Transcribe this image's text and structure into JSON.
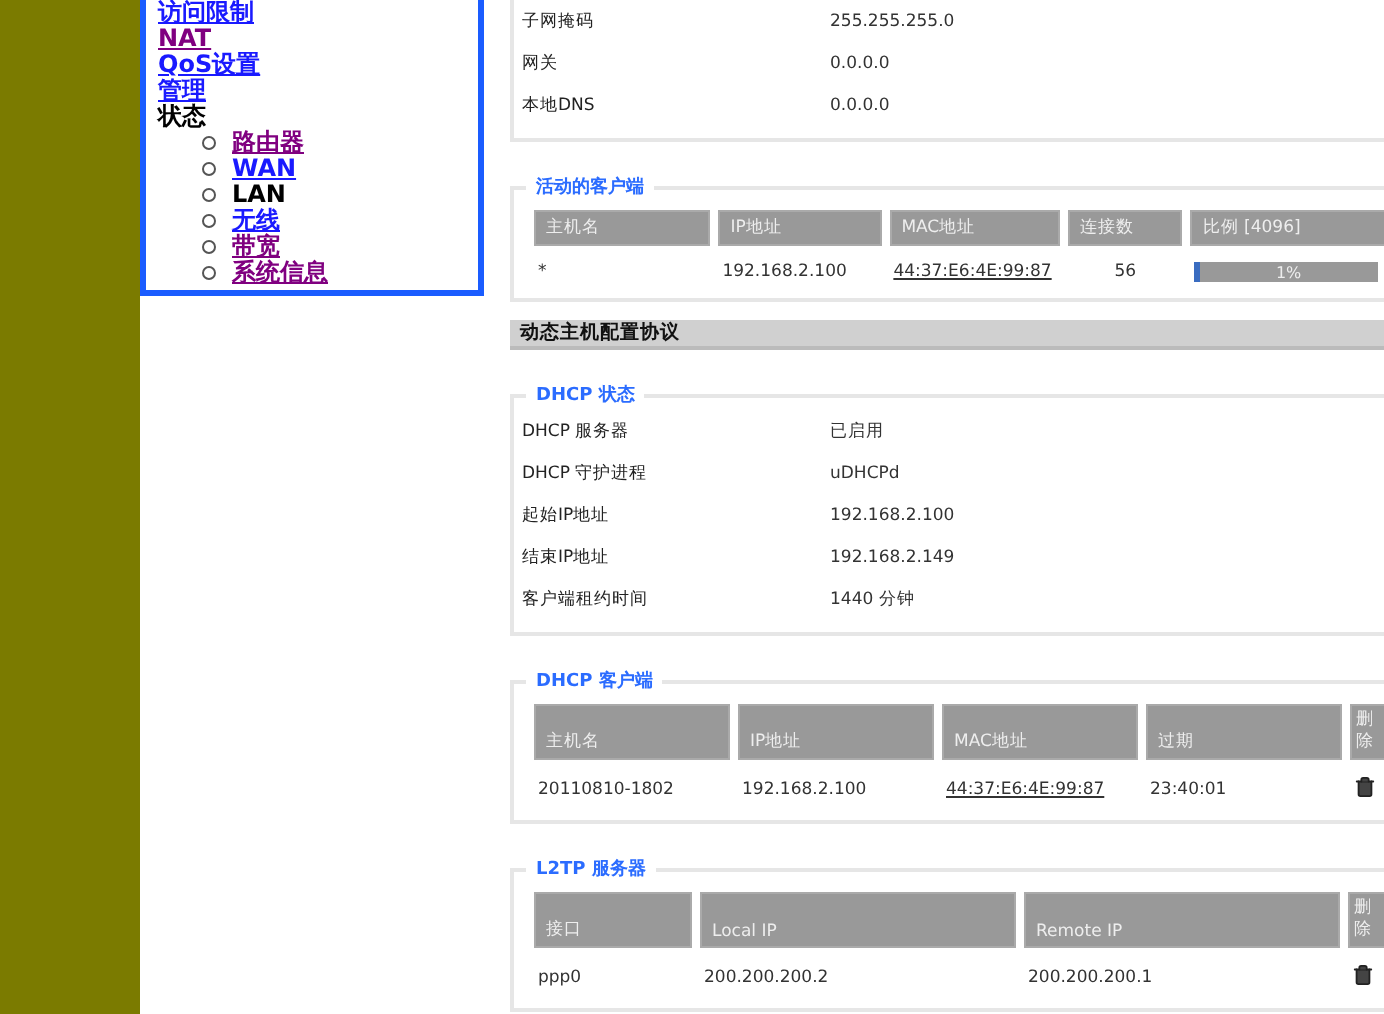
{
  "sidebar": {
    "items": [
      {
        "label": "访问限制",
        "kind": "link"
      },
      {
        "label": "NAT",
        "kind": "visited"
      },
      {
        "label": "QoS设置",
        "kind": "link"
      },
      {
        "label": "管理",
        "kind": "link"
      },
      {
        "label": "状态",
        "kind": "plain",
        "children": [
          {
            "label": "路由器",
            "kind": "visited"
          },
          {
            "label": "WAN",
            "kind": "link"
          },
          {
            "label": "LAN",
            "kind": "current"
          },
          {
            "label": "无线",
            "kind": "link"
          },
          {
            "label": "带宽",
            "kind": "visited"
          },
          {
            "label": "系统信息",
            "kind": "visited"
          }
        ]
      }
    ]
  },
  "lan_info": {
    "rows": [
      {
        "label": "子网掩码",
        "value": "255.255.255.0"
      },
      {
        "label": "网关",
        "value": "0.0.0.0"
      },
      {
        "label": "本地DNS",
        "value": "0.0.0.0"
      }
    ]
  },
  "active_clients": {
    "legend": "活动的客户端",
    "columns": [
      "主机名",
      "IP地址",
      "MAC地址",
      "连接数",
      "比例 [4096]"
    ],
    "rows": [
      {
        "host": "*",
        "ip": "192.168.2.100",
        "mac": "44:37:E6:4E:99:87",
        "connections": "56",
        "share": "1%",
        "level": 0.01
      }
    ]
  },
  "section_title": "动态主机配置协议",
  "dhcp_status": {
    "legend": "DHCP 状态",
    "rows": [
      {
        "label": "DHCP 服务器",
        "value": "已启用"
      },
      {
        "label": "DHCP 守护进程",
        "value": "uDHCPd"
      },
      {
        "label": "起始IP地址",
        "value": "192.168.2.100"
      },
      {
        "label": "结束IP地址",
        "value": "192.168.2.149"
      },
      {
        "label": "客户端租约时间",
        "value": "1440 分钟"
      }
    ]
  },
  "dhcp_clients": {
    "legend": "DHCP 客户端",
    "columns": [
      "主机名",
      "IP地址",
      "MAC地址",
      "过期",
      "删除"
    ],
    "rows": [
      {
        "cells": [
          {
            "text": "20110810-1802",
            "kind": "text"
          },
          {
            "text": "192.168.2.100",
            "kind": "text"
          },
          {
            "text": "44:37:E6:4E:99:87",
            "kind": "link"
          },
          {
            "text": "23:40:01",
            "kind": "text"
          }
        ]
      }
    ]
  },
  "l2tp_server": {
    "legend": "L2TP 服务器",
    "columns": [
      "接口",
      "Local IP",
      "Remote IP",
      "删除"
    ],
    "rows": [
      {
        "cells": [
          {
            "text": "ppp0",
            "kind": "text"
          },
          {
            "text": "200.200.200.2",
            "kind": "text"
          },
          {
            "text": "200.200.200.1",
            "kind": "text"
          }
        ]
      }
    ]
  }
}
